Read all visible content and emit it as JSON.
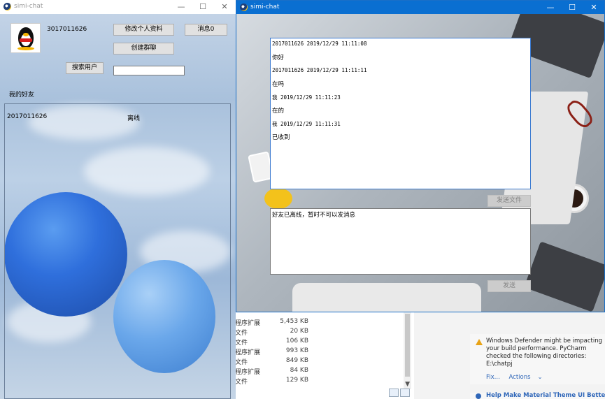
{
  "main_window": {
    "title": "simi-chat",
    "user_id": "3017011626",
    "edit_profile_label": "修改个人资料",
    "messages_label": "消息0",
    "create_group_label": "创建群聊",
    "search_users_label": "搜索用户",
    "search_value": "",
    "friends_heading": "我的好友",
    "friends": [
      {
        "name": "2017011626",
        "status": "离线"
      }
    ]
  },
  "chat_window": {
    "title": "simi-chat",
    "messages": [
      {
        "meta": "2017011626 2019/12/29 11:11:08",
        "text": "你好"
      },
      {
        "meta": "2017011626 2019/12/29 11:11:11",
        "text": "在吗"
      },
      {
        "meta": "我 2019/12/29 11:11:23",
        "text": "在的"
      },
      {
        "meta": "我 2019/12/29 11:11:31",
        "text": "已收到"
      }
    ],
    "send_file_label": "发送文件",
    "input_text": "好友已离线，暂时不可以发消息",
    "send_label": "发送"
  },
  "explorer": {
    "rows": [
      {
        "kind": "程序扩展",
        "size": "5,453 KB"
      },
      {
        "kind": "文件",
        "size": "20 KB"
      },
      {
        "kind": "文件",
        "size": "106 KB"
      },
      {
        "kind": "程序扩展",
        "size": "993 KB"
      },
      {
        "kind": "文件",
        "size": "849 KB"
      },
      {
        "kind": "程序扩展",
        "size": "84 KB"
      },
      {
        "kind": "文件",
        "size": "129 KB"
      }
    ]
  },
  "notification": {
    "text": "Windows Defender might be impacting your build performance. PyCharm checked the following directories:",
    "path": "E:\\chatpj",
    "fix_link": "Fix...",
    "actions_link": "Actions",
    "next_title": "Help Make Material Theme UI Better"
  },
  "colors": {
    "active_titlebar": "#0a6fd1",
    "button_face": "#e1e1e1",
    "link": "#2f66b8",
    "warning": "#e8a317"
  }
}
